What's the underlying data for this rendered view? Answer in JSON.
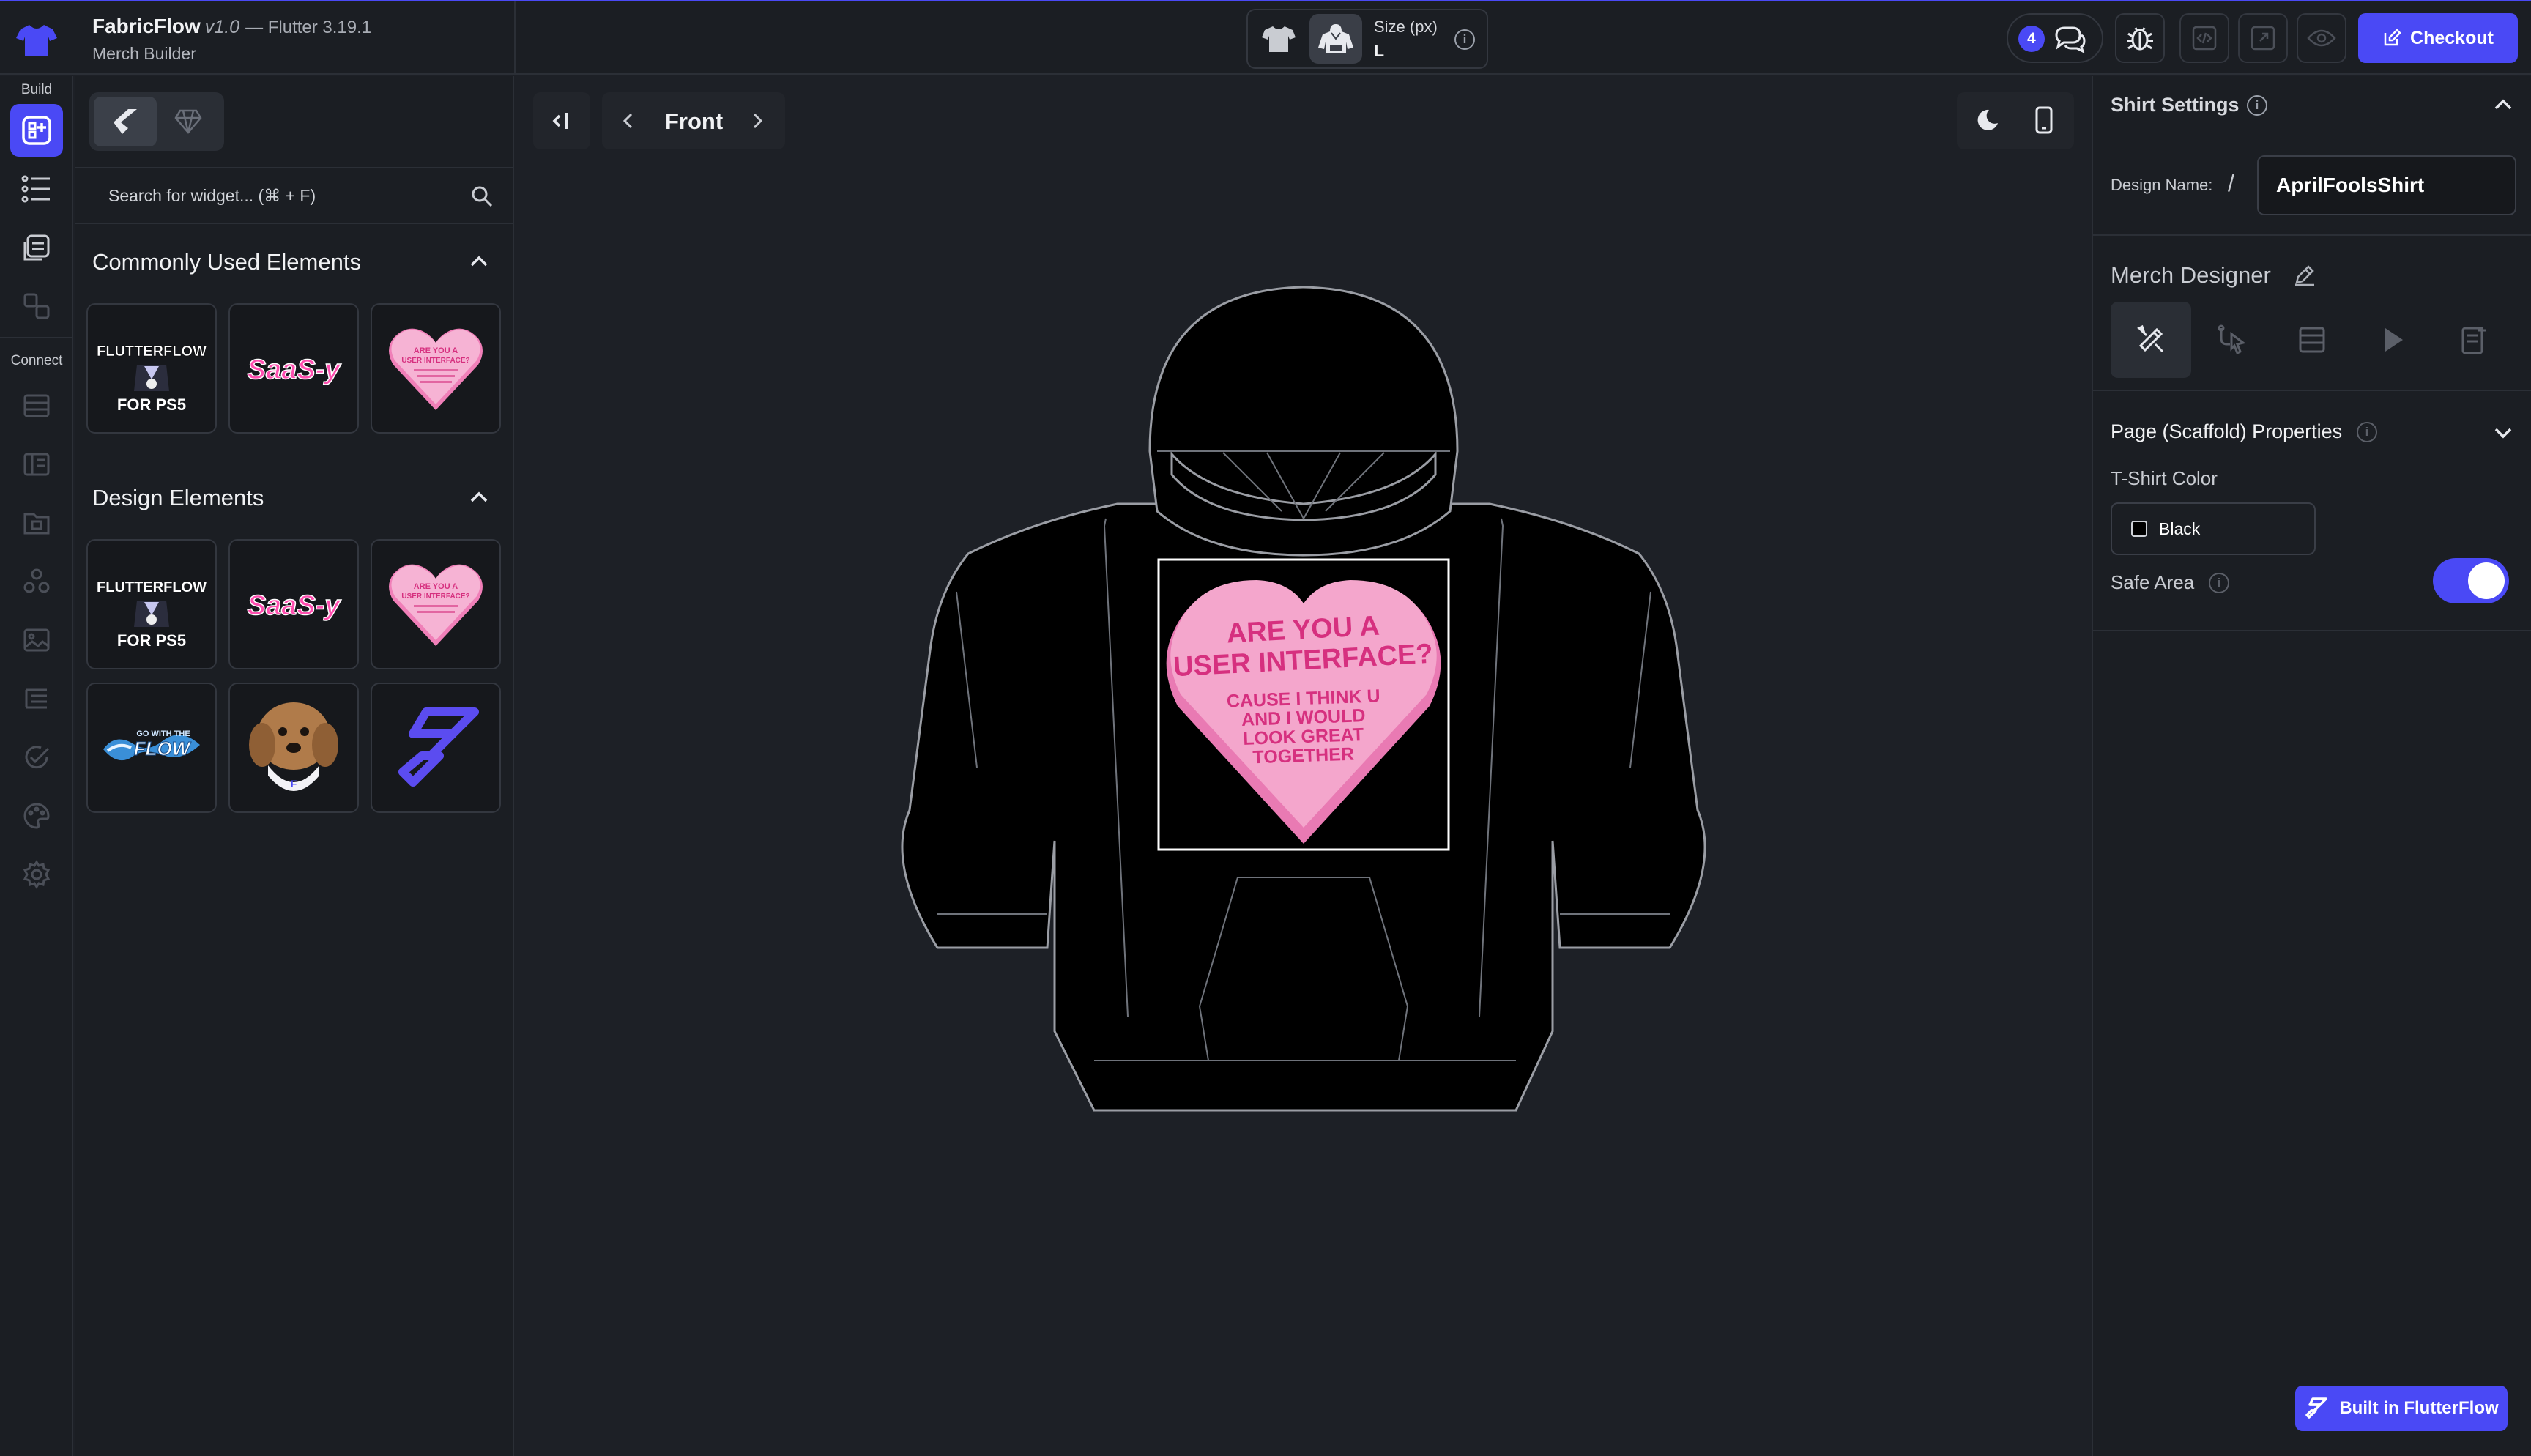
{
  "app": {
    "name": "FabricFlow",
    "version": "v1.0",
    "flutter": "— Flutter 3.19.1",
    "subtitle": "Merch Builder"
  },
  "topbar": {
    "size_label": "Size (px)",
    "size_value": "L",
    "notification_count": "4",
    "checkout_label": "Checkout"
  },
  "rail": {
    "build_label": "Build",
    "connect_label": "Connect"
  },
  "left_panel": {
    "search_placeholder": "Search for widget... (⌘ + F)",
    "common_title": "Commonly Used Elements",
    "design_title": "Design Elements",
    "common_items": [
      "flutterflow-ps5-sticker",
      "saas-y-sticker",
      "heart-candy-sticker"
    ],
    "design_items": [
      "flutterflow-ps5-sticker",
      "saas-y-sticker",
      "heart-candy-sticker",
      "go-with-the-flow-sticker",
      "dog-photo-sticker",
      "flutterflow-logo-sticker"
    ],
    "ps5_line1": "FLUTTERFLOW",
    "ps5_line2": "FOR PS5",
    "saasy_text": "SaaS-y",
    "heart_small_line1": "ARE YOU A",
    "heart_small_line2": "USER INTERFACE?",
    "flow_line1": "GO WITH THE",
    "flow_line2": "FLOW"
  },
  "canvas": {
    "view_label": "Front",
    "design_text": {
      "line1": "ARE YOU A",
      "line2": "USER INTERFACE?",
      "line3": "CAUSE I THINK U",
      "line4": "AND I WOULD",
      "line5": "LOOK GREAT",
      "line6": "TOGETHER"
    },
    "garment_color": "#000000",
    "heart_color": "#f4a6cc",
    "heart_text_color": "#d6307f"
  },
  "right_panel": {
    "shirt_settings_title": "Shirt Settings",
    "design_name_label": "Design Name:",
    "design_name_sep": "/",
    "design_name_value": "AprilFoolsShirt",
    "merch_designer_title": "Merch Designer",
    "page_props_title": "Page (Scaffold) Properties",
    "tshirt_color_label": "T-Shirt Color",
    "tshirt_color_value": "Black",
    "safe_area_label": "Safe Area",
    "safe_area_on": true
  },
  "footer": {
    "built_label": "Built in FlutterFlow"
  },
  "colors": {
    "accent": "#4a49f5",
    "background": "#1d2026",
    "panel": "#1b1e23"
  }
}
